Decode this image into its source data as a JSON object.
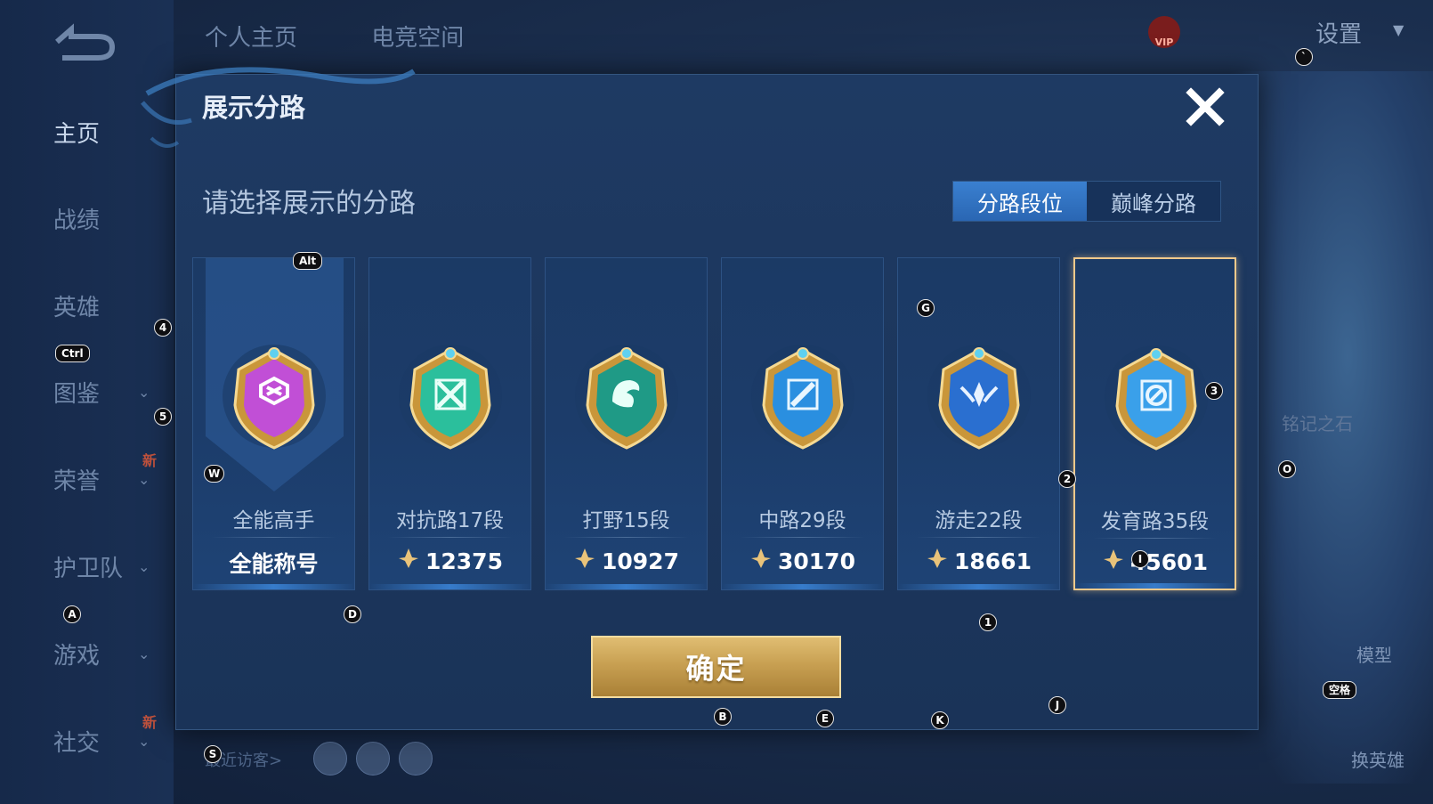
{
  "sidebar": {
    "items": [
      {
        "label": "主页",
        "active": true,
        "chevron": false,
        "new": false
      },
      {
        "label": "战绩",
        "active": false,
        "chevron": false,
        "new": false
      },
      {
        "label": "英雄",
        "active": false,
        "chevron": false,
        "new": false
      },
      {
        "label": "图鉴",
        "active": false,
        "chevron": true,
        "new": false
      },
      {
        "label": "荣誉",
        "active": false,
        "chevron": true,
        "new": true
      },
      {
        "label": "护卫队",
        "active": false,
        "chevron": true,
        "new": false
      },
      {
        "label": "游戏",
        "active": false,
        "chevron": true,
        "new": false
      },
      {
        "label": "社交",
        "active": false,
        "chevron": true,
        "new": true
      }
    ],
    "new_badge": "新",
    "chevron_icon": "chevron-down-icon"
  },
  "top_tabs": [
    "个人主页",
    "电竞空间"
  ],
  "settings_label": "设置",
  "vip_label": "VIP",
  "background_right": {
    "model_label": "模型",
    "switch_hero_label": "换英雄",
    "stone_label": "铭记之石"
  },
  "visitors_label": "最近访客>",
  "modal": {
    "title": "展示分路",
    "subtitle": "请选择展示的分路",
    "tabs": [
      {
        "label": "分路段位",
        "active": true
      },
      {
        "label": "巅峰分路",
        "active": false
      }
    ],
    "cards": [
      {
        "name": "全能高手",
        "score": "全能称号",
        "show_score_icon": false,
        "emblem": "all-round-emblem-icon",
        "selected": false,
        "color": "#c14fd6"
      },
      {
        "name": "对抗路17段",
        "score": "12375",
        "show_score_icon": true,
        "emblem": "clash-lane-emblem-icon",
        "selected": false,
        "color": "#2bbf9c"
      },
      {
        "name": "打野15段",
        "score": "10927",
        "show_score_icon": true,
        "emblem": "jungle-emblem-icon",
        "selected": false,
        "color": "#1f9a86"
      },
      {
        "name": "中路29段",
        "score": "30170",
        "show_score_icon": true,
        "emblem": "mid-lane-emblem-icon",
        "selected": false,
        "color": "#2a8fe0"
      },
      {
        "name": "游走22段",
        "score": "18661",
        "show_score_icon": true,
        "emblem": "roam-emblem-icon",
        "selected": false,
        "color": "#2a6fd0"
      },
      {
        "name": "发育路35段",
        "score": "45601",
        "show_score_icon": true,
        "emblem": "farm-lane-emblem-icon",
        "selected": true,
        "color": "#3aa0ea"
      }
    ],
    "confirm_label": "确定",
    "close_icon": "close-icon"
  },
  "key_hints": [
    {
      "key": "Alt"
    },
    {
      "key": "Ctrl"
    },
    {
      "key": "4"
    },
    {
      "key": "5"
    },
    {
      "key": "W"
    },
    {
      "key": "A"
    },
    {
      "key": "D"
    },
    {
      "key": "S"
    },
    {
      "key": "B"
    },
    {
      "key": "E"
    },
    {
      "key": "K"
    },
    {
      "key": "J"
    },
    {
      "key": "1"
    },
    {
      "key": "G"
    },
    {
      "key": "2"
    },
    {
      "key": "3"
    },
    {
      "key": "I"
    },
    {
      "key": "O"
    },
    {
      "key": "空格"
    },
    {
      "key": "`"
    }
  ],
  "colors": {
    "accent_gold": "#f2c98b",
    "tab_active": "#3a80d0",
    "modal_bg": "#1e3a63"
  }
}
